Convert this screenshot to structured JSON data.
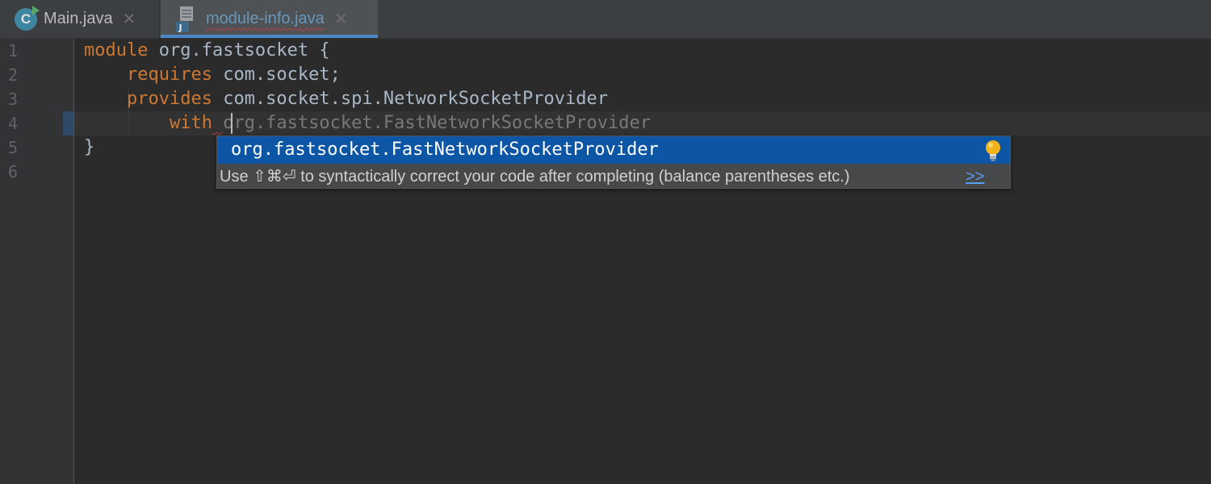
{
  "tabs": [
    {
      "label": "Main.java",
      "icon": "class-icon",
      "icon_letter": "C",
      "active": false
    },
    {
      "label": "module-info.java",
      "icon": "java-file-icon",
      "icon_letter": "J",
      "active": true
    }
  ],
  "gutter": {
    "line_numbers": [
      "1",
      "2",
      "3",
      "4",
      "5",
      "6"
    ]
  },
  "code": {
    "line1": {
      "keyword": "module",
      "rest": " org.fastsocket {"
    },
    "line2": {
      "indent": "    ",
      "keyword": "requires",
      "rest": " com.socket;"
    },
    "line3": {
      "indent": "    ",
      "keyword": "provides",
      "rest": " com.socket.spi.NetworkSocketProvider"
    },
    "line4": {
      "indent": "        ",
      "keyword": "with",
      "space": " ",
      "ghost": "org.fastsocket.FastNetworkSocketProvider"
    },
    "line5": {
      "text": "}"
    },
    "line6": {
      "text": ""
    }
  },
  "completion": {
    "selected_item": "org.fastsocket.FastNetworkSocketProvider",
    "hint": "Use ⇧⌘⏎ to syntactically correct your code after completing (balance parentheses etc.)",
    "hint_link": ">>",
    "icon": "lightbulb-icon"
  },
  "colors": {
    "editor_bg": "#2b2b2b",
    "keyword": "#cc7832",
    "identifier": "#a9b7c6",
    "selection": "#0d56a6",
    "link": "#589df6"
  }
}
